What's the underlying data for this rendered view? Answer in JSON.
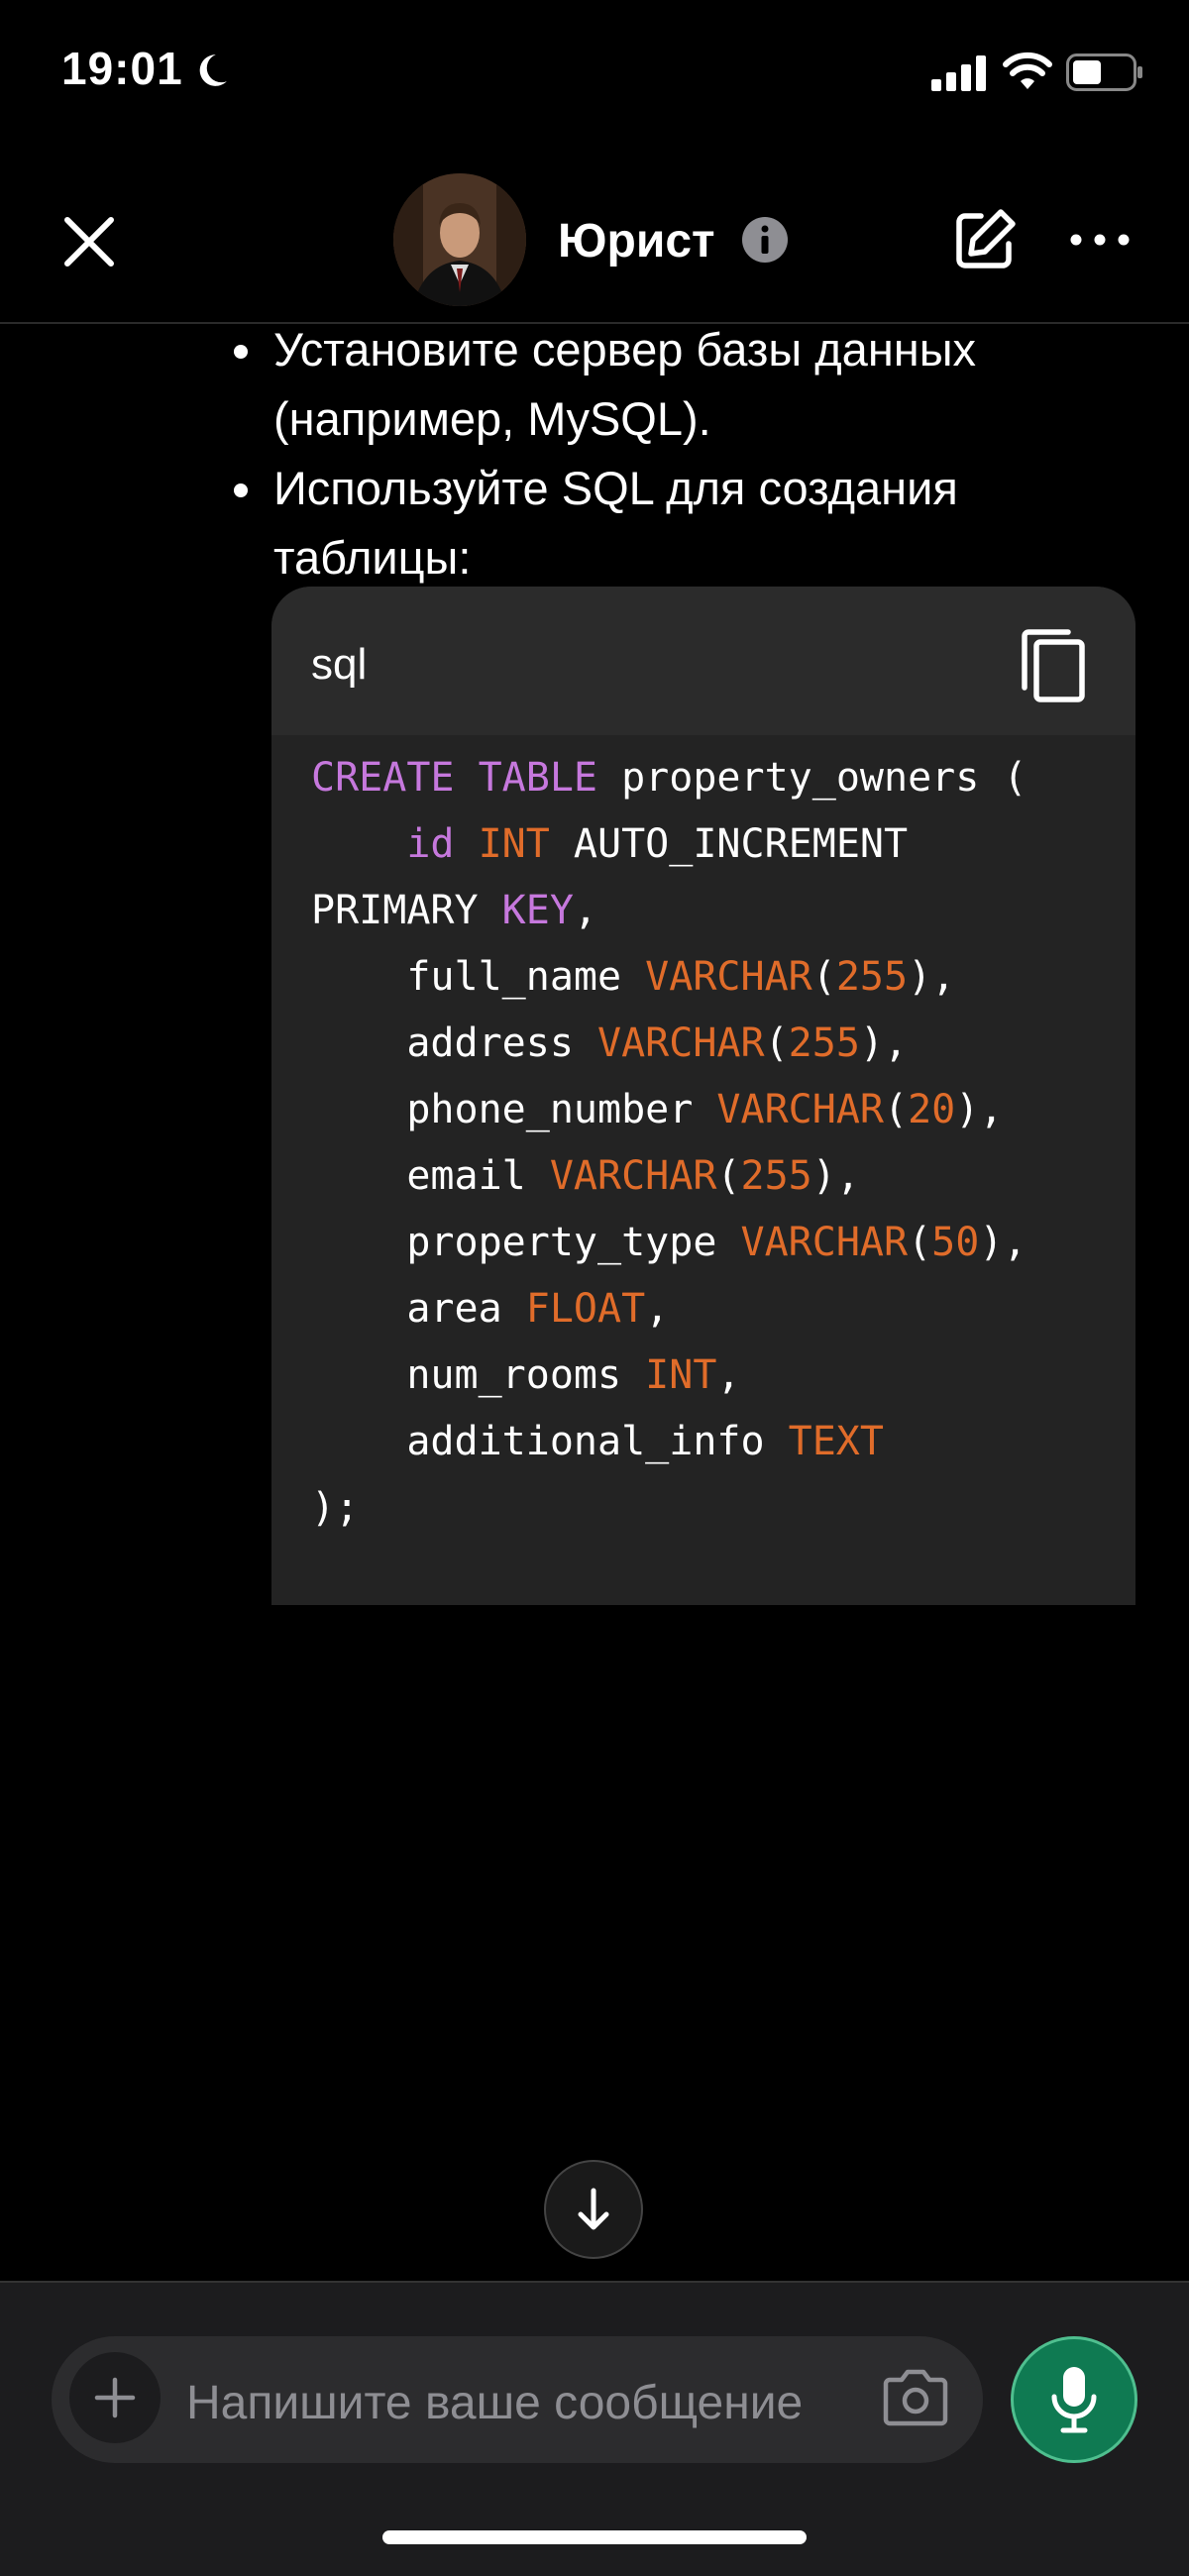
{
  "status_bar": {
    "time": "19:01",
    "icons": [
      "moon-icon",
      "signal-icon",
      "wifi-icon",
      "battery-icon"
    ]
  },
  "header": {
    "title": "Юрист",
    "icons": [
      "close-icon",
      "avatar",
      "info-icon",
      "edit-icon",
      "more-icon"
    ]
  },
  "message": {
    "bullets": [
      "Установите сервер базы данных (например, MySQL).",
      "Используйте SQL для создания таблицы:"
    ],
    "code_block": {
      "language": "sql",
      "tokens": {
        "create": "CREATE",
        "table": "TABLE",
        "table_name": " property_owners (",
        "id": "id",
        "int": "INT",
        "auto_increment": " AUTO_INCREMENT",
        "primary": "PRIMARY ",
        "key": "KEY",
        "comma": ",",
        "full_name": "full_name ",
        "address": "address ",
        "phone_number": "phone_number ",
        "email": "email ",
        "property_type": "property_type ",
        "area": "area ",
        "num_rooms": "num_rooms ",
        "additional_info": "additional_info ",
        "varchar": "VARCHAR",
        "float": "FLOAT",
        "text": "TEXT",
        "n255": "255",
        "n20": "20",
        "n50": "50",
        "close": ");"
      }
    }
  },
  "composer": {
    "placeholder": "Напишите ваше сообщение"
  },
  "colors": {
    "keyword_purple": "#c678dd",
    "keyword_orange": "#e06c2a",
    "mic_green": "#0f7a52"
  }
}
